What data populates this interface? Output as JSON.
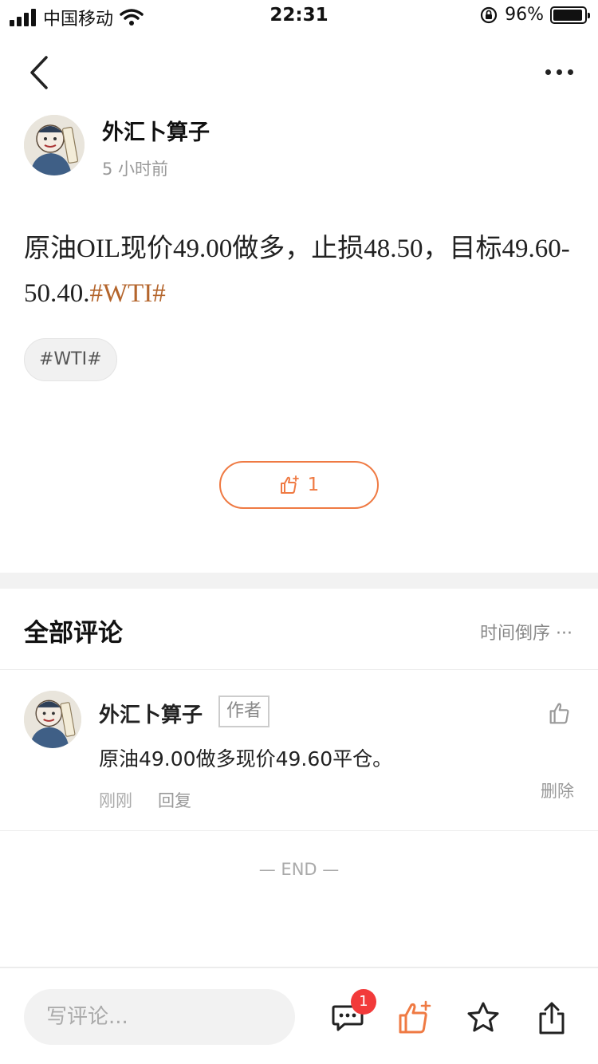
{
  "status_bar": {
    "carrier": "中国移动",
    "time": "22:31",
    "battery": "96%",
    "battery_level": 0.96
  },
  "nav": {
    "back_icon": "chevron-left-icon",
    "more_icon": "more-horizontal-icon"
  },
  "post": {
    "author_name": "外汇卜算子",
    "time_ago": "5 小时前",
    "text_main": "原油OIL现价49.00做多，止损48.50，目标49.60-50.40.",
    "text_hashtag": "#WTI#",
    "tag": "#WTI#",
    "like_count": "1"
  },
  "comments": {
    "title": "全部评论",
    "sort_label": "时间倒序 ···",
    "items": [
      {
        "author": "外汇卜算子",
        "badge": "作者",
        "text": "原油49.00做多现价49.60平仓。",
        "time": "刚刚",
        "reply": "回复",
        "delete": "删除"
      }
    ],
    "end_text": "— END —"
  },
  "bottom_bar": {
    "input_placeholder": "写评论...",
    "comment_badge": "1"
  },
  "colors": {
    "accent": "#ef7a43",
    "hashtag": "#b4652c",
    "badge_red": "#f23a3a"
  }
}
